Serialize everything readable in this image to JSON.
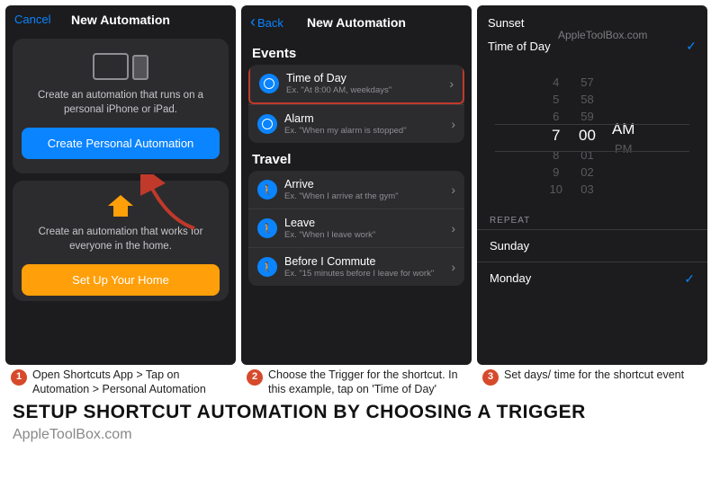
{
  "panel1": {
    "cancel": "Cancel",
    "title": "New Automation",
    "card1_desc": "Create an automation that runs on a personal iPhone or iPad.",
    "card1_btn": "Create Personal Automation",
    "card2_desc": "Create an automation that works for everyone in the home.",
    "card2_btn": "Set Up Your Home"
  },
  "panel2": {
    "back": "Back",
    "title": "New Automation",
    "events_label": "Events",
    "travel_label": "Travel",
    "rows": {
      "time": {
        "label": "Time of Day",
        "sub": "Ex. \"At 8:00 AM, weekdays\""
      },
      "alarm": {
        "label": "Alarm",
        "sub": "Ex. \"When my alarm is stopped\""
      },
      "arrive": {
        "label": "Arrive",
        "sub": "Ex. \"When I arrive at the gym\""
      },
      "leave": {
        "label": "Leave",
        "sub": "Ex. \"When I leave work\""
      },
      "commute": {
        "label": "Before I Commute",
        "sub": "Ex. \"15 minutes before I leave for work\""
      }
    }
  },
  "panel3": {
    "sunset": "Sunset",
    "tod": "Time of Day",
    "watermark": "AppleToolBox.com",
    "hours": [
      "4",
      "5",
      "6",
      "7",
      "8",
      "9",
      "10"
    ],
    "mins": [
      "57",
      "58",
      "59",
      "00",
      "01",
      "02",
      "03"
    ],
    "ampm": [
      "",
      "",
      "",
      "AM",
      "PM",
      "",
      ""
    ],
    "repeat": "REPEAT",
    "days": {
      "sunday": "Sunday",
      "monday": "Monday"
    }
  },
  "captions": {
    "c1": "Open Shortcuts App > Tap on Automation > Personal Automation",
    "c2": "Choose the Trigger for the shortcut. In this example, tap on 'Time of Day'",
    "c3": "Set days/ time for the shortcut event"
  },
  "title": "SETUP SHORTCUT AUTOMATION BY CHOOSING A TRIGGER",
  "site": "AppleToolBox.com"
}
